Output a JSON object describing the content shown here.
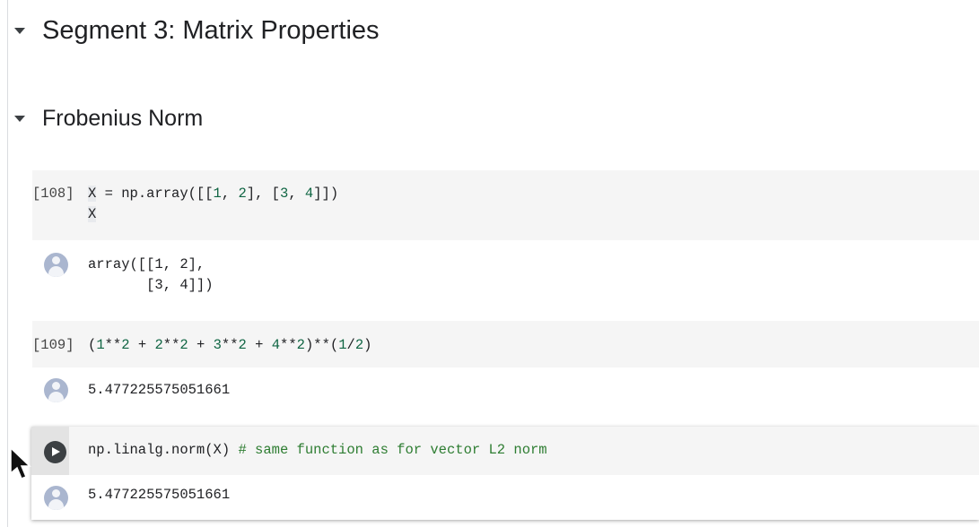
{
  "headings": {
    "segment": "Segment 3: Matrix Properties",
    "section": "Frobenius Norm"
  },
  "cells": [
    {
      "prompt": "[108]",
      "code_line1": [
        "X",
        " = np.array([[",
        "1",
        ", ",
        "2",
        "], [",
        "3",
        ", ",
        "4",
        "]])"
      ],
      "code_line2": "X",
      "output": [
        "array([[1, 2],",
        "       [3, 4]])"
      ]
    },
    {
      "prompt": "[109]",
      "code": [
        "(",
        "1",
        "**",
        "2",
        " + ",
        "2",
        "**",
        "2",
        " + ",
        "3",
        "**",
        "2",
        " + ",
        "4",
        "**",
        "2",
        ")**(",
        "1",
        "/",
        "2",
        ")"
      ],
      "output": "5.477225575051661"
    },
    {
      "code": "np.linalg.norm(X) ",
      "comment": "# same function as for vector L2 norm",
      "output": "5.477225575051661"
    }
  ]
}
